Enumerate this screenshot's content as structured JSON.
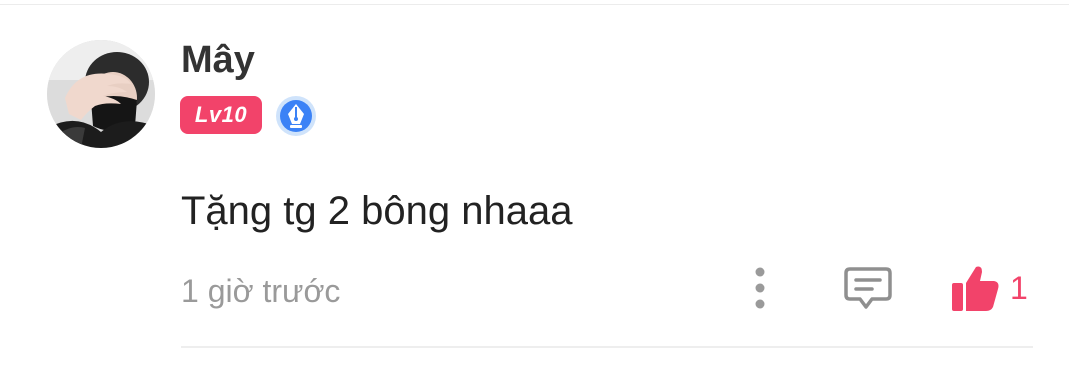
{
  "comment": {
    "user": {
      "name": "Mây",
      "level": "Lv10",
      "avatar_icon": "avatar-photo",
      "badge_icon": "pen-nib-icon"
    },
    "text": "Tặng tg 2 bông nhaaa",
    "timestamp": "1 giờ trước",
    "actions": {
      "more_icon": "more-vertical-icon",
      "reply_icon": "comment-icon",
      "like_icon": "thumbs-up-icon",
      "like_count": "1"
    }
  },
  "colors": {
    "accent": "#f2436a",
    "badge_blue": "#3b82f6",
    "muted_text": "#9a9a9a",
    "body_text": "#222222"
  }
}
